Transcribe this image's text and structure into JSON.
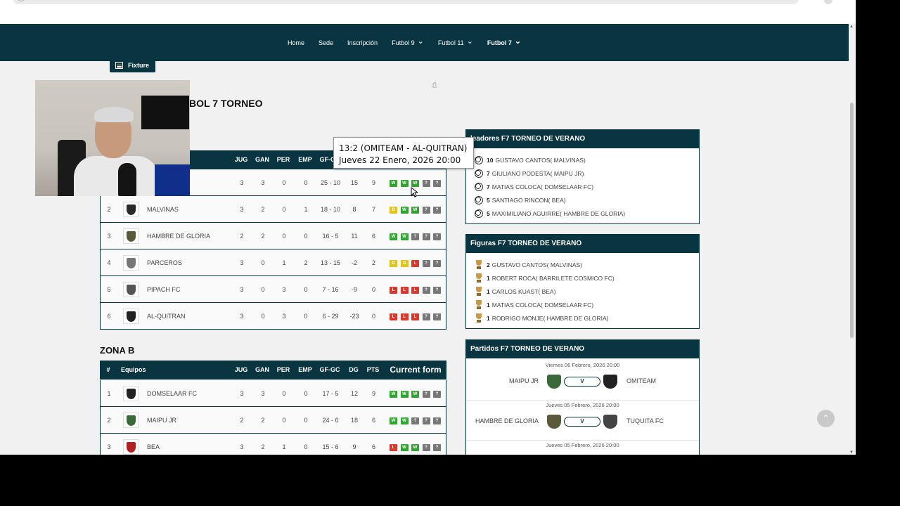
{
  "nav": {
    "items": [
      {
        "label": "Home",
        "dropdown": false
      },
      {
        "label": "Sede",
        "dropdown": false
      },
      {
        "label": "Inscripción",
        "dropdown": false
      },
      {
        "label": "Futbol 9",
        "dropdown": true
      },
      {
        "label": "Futbol 11",
        "dropdown": true
      },
      {
        "label": "Futbol 7",
        "dropdown": true,
        "active": true
      }
    ]
  },
  "fixture_tab": "Fixture",
  "page_title": "BOL 7 TORNEO",
  "tooltip": {
    "line1": "13:2 (OMITEAM - AL-QUITRAN)",
    "line2": "Jueves 22 Enero, 2026 20:00"
  },
  "table_headers": {
    "pos": "#",
    "team": "Equipos",
    "jug": "JUG",
    "gan": "GAN",
    "per": "PER",
    "emp": "EMP",
    "gf": "GF-GC",
    "dg": "DG",
    "pts": "PTS",
    "form": "Current form"
  },
  "zona_a": {
    "rows": [
      {
        "pos": "1",
        "team": "",
        "jug": "3",
        "gan": "3",
        "per": "0",
        "emp": "0",
        "gf": "25 - 10",
        "dg": "15",
        "pts": "9",
        "form": [
          "W",
          "W",
          "W",
          "?",
          "?"
        ],
        "logo_color": "#444"
      },
      {
        "pos": "2",
        "team": "MALVINAS",
        "jug": "3",
        "gan": "2",
        "per": "0",
        "emp": "1",
        "gf": "18 - 10",
        "dg": "8",
        "pts": "7",
        "form": [
          "D",
          "W",
          "W",
          "?",
          "?"
        ],
        "logo_color": "#2a2a2a"
      },
      {
        "pos": "3",
        "team": "HAMBRE DE GLORIA",
        "jug": "2",
        "gan": "2",
        "per": "0",
        "emp": "0",
        "gf": "16 - 5",
        "dg": "11",
        "pts": "6",
        "form": [
          "W",
          "W",
          "?",
          "?",
          "?"
        ],
        "logo_color": "#5a5a3a"
      },
      {
        "pos": "4",
        "team": "PARCEROS",
        "jug": "3",
        "gan": "0",
        "per": "1",
        "emp": "2",
        "gf": "13 - 15",
        "dg": "-2",
        "pts": "2",
        "form": [
          "D",
          "D",
          "L",
          "?",
          "?"
        ],
        "logo_color": "#777"
      },
      {
        "pos": "5",
        "team": "PIPACH FC",
        "jug": "3",
        "gan": "0",
        "per": "3",
        "emp": "0",
        "gf": "7 - 16",
        "dg": "-9",
        "pts": "0",
        "form": [
          "L",
          "L",
          "L",
          "?",
          "?"
        ],
        "logo_color": "#555"
      },
      {
        "pos": "6",
        "team": "AL-QUITRAN",
        "jug": "3",
        "gan": "0",
        "per": "3",
        "emp": "0",
        "gf": "6 - 29",
        "dg": "-23",
        "pts": "0",
        "form": [
          "L",
          "L",
          "L",
          "?",
          "?"
        ],
        "logo_color": "#222"
      }
    ]
  },
  "zona_b": {
    "title": "ZONA B",
    "rows": [
      {
        "pos": "1",
        "team": "DOMSELAAR FC",
        "jug": "3",
        "gan": "3",
        "per": "0",
        "emp": "0",
        "gf": "17 - 5",
        "dg": "12",
        "pts": "9",
        "form": [
          "W",
          "W",
          "W",
          "?",
          "?"
        ],
        "logo_color": "#222"
      },
      {
        "pos": "2",
        "team": "MAIPU JR",
        "jug": "2",
        "gan": "2",
        "per": "0",
        "emp": "0",
        "gf": "24 - 6",
        "dg": "18",
        "pts": "6",
        "form": [
          "W",
          "W",
          "?",
          "?",
          "?"
        ],
        "logo_color": "#3a6a3a"
      },
      {
        "pos": "3",
        "team": "BEA",
        "jug": "3",
        "gan": "2",
        "per": "1",
        "emp": "0",
        "gf": "15 - 6",
        "dg": "9",
        "pts": "6",
        "form": [
          "L",
          "W",
          "W",
          "?",
          "?"
        ],
        "logo_color": "#b02020"
      }
    ]
  },
  "goleadores": {
    "title": "leadores F7 TORNEO DE VERANO",
    "items": [
      {
        "num": "10",
        "text": "GUSTAVO CANTOS( MALVINAS)"
      },
      {
        "num": "7",
        "text": "GIULIANO PODESTA( MAIPU JR)"
      },
      {
        "num": "7",
        "text": "MATIAS COLOCA( DOMSELAAR FC)"
      },
      {
        "num": "5",
        "text": "SANTIAGO RINCON( BEA)"
      },
      {
        "num": "5",
        "text": "MAXIMILIANO AGUIRRE( HAMBRE DE GLORIA)"
      }
    ]
  },
  "figuras": {
    "title": "Figuras F7 TORNEO DE VERANO",
    "items": [
      {
        "num": "2",
        "text": "GUSTAVO CANTOS( MALVINAS)"
      },
      {
        "num": "1",
        "text": "ROBERT ROCA( BARRILETE COSMICO FC)"
      },
      {
        "num": "1",
        "text": "CARLOS KUAST( BEA)"
      },
      {
        "num": "1",
        "text": "MATIAS COLOCA( DOMSELAAR FC)"
      },
      {
        "num": "1",
        "text": "RODRIGO MONJE( HAMBRE DE GLORIA)"
      }
    ]
  },
  "partidos": {
    "title": "Partidos F7 TORNEO DE VERANO",
    "matches": [
      {
        "date": "Viernes 06 Febrero, 2026 20:00",
        "home": "MAIPU JR",
        "vs": "V",
        "away": "OMITEAM",
        "home_color": "#3a6a3a",
        "away_color": "#222"
      },
      {
        "date": "Jueves 05 Febrero, 2026 20:00",
        "home": "HAMBRE DE GLORIA",
        "vs": "V",
        "away": "TUQUITA FC",
        "home_color": "#5a5a3a",
        "away_color": "#444"
      },
      {
        "date": "Jueves 05 Febrero, 2026 20:00",
        "home": "",
        "vs": "",
        "away": "",
        "home_color": "#fff",
        "away_color": "#fff"
      }
    ]
  }
}
